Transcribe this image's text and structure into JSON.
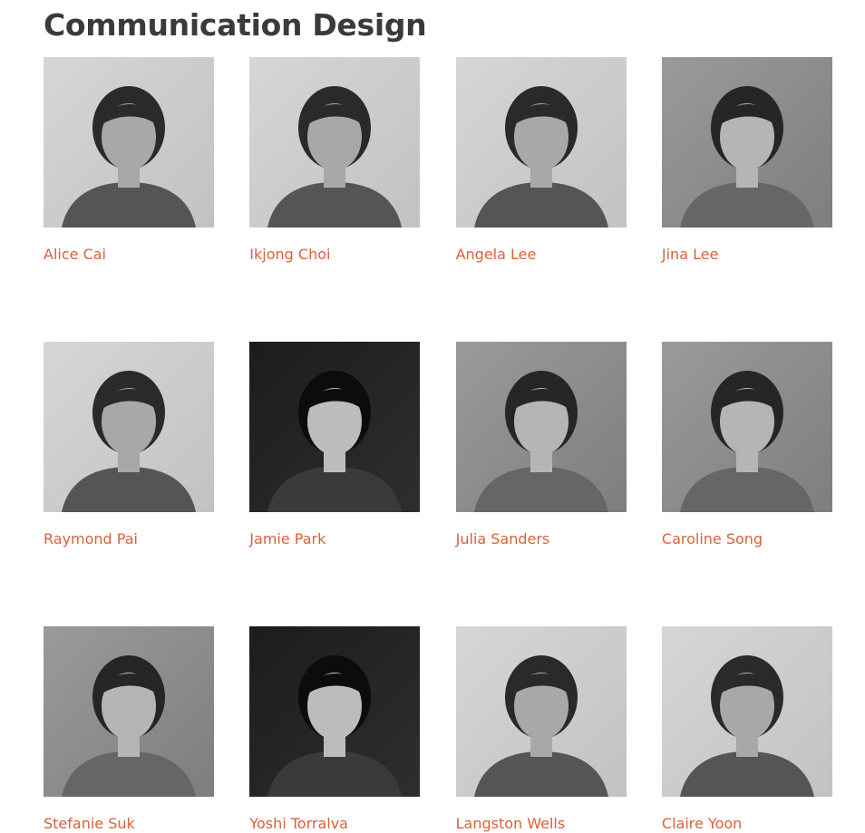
{
  "section": {
    "title": "Communication Design"
  },
  "accent_color": "#d9613a",
  "people": [
    {
      "name": "Alice Cai",
      "photo": "portrait-photo",
      "tone": "light"
    },
    {
      "name": "Ikjong Choi",
      "photo": "portrait-photo",
      "tone": "light"
    },
    {
      "name": "Angela Lee",
      "photo": "portrait-photo",
      "tone": "light"
    },
    {
      "name": "Jina Lee",
      "photo": "portrait-photo",
      "tone": "mid"
    },
    {
      "name": "Raymond Pai",
      "photo": "portrait-photo",
      "tone": "light"
    },
    {
      "name": "Jamie Park",
      "photo": "portrait-photo",
      "tone": "dark"
    },
    {
      "name": "Julia Sanders",
      "photo": "portrait-photo",
      "tone": "mid"
    },
    {
      "name": "Caroline Song",
      "photo": "portrait-photo",
      "tone": "mid"
    },
    {
      "name": "Stefanie Suk",
      "photo": "portrait-photo",
      "tone": "mid"
    },
    {
      "name": "Yoshi Torralva",
      "photo": "portrait-photo",
      "tone": "dark"
    },
    {
      "name": "Langston Wells",
      "photo": "portrait-photo",
      "tone": "light"
    },
    {
      "name": "Claire Yoon",
      "photo": "portrait-photo",
      "tone": "light"
    }
  ]
}
